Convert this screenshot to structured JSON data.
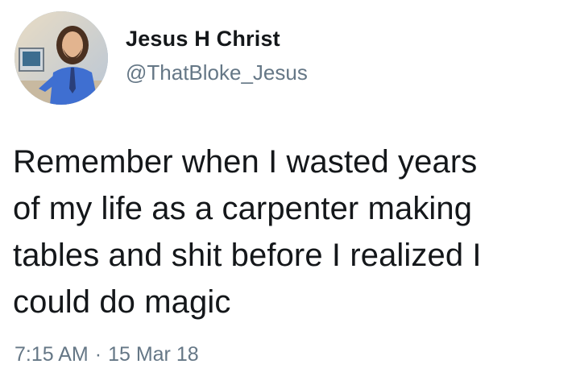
{
  "tweet": {
    "author": {
      "display_name": "Jesus H Christ",
      "handle": "@ThatBloke_Jesus"
    },
    "text": "Remember when I wasted years\nof my life as a carpenter making\ntables and shit before I realized I\ncould do magic",
    "time": "7:15 AM",
    "separator": "·",
    "date": "15 Mar 18"
  },
  "colors": {
    "text_primary": "#14171a",
    "text_secondary": "#657786",
    "background": "#ffffff"
  }
}
